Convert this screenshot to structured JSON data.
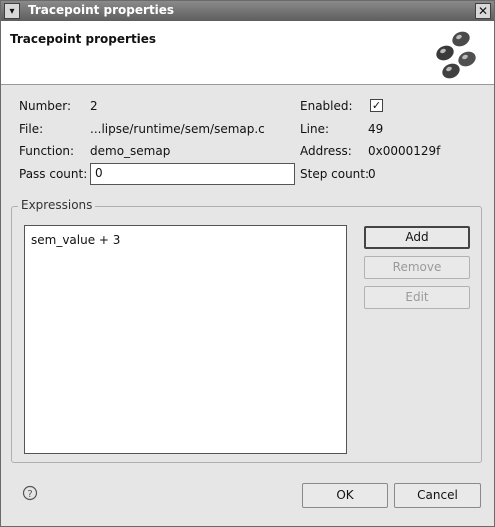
{
  "window": {
    "title": "Tracepoint properties",
    "menu_glyph": "▾",
    "close_glyph": "✕"
  },
  "header": {
    "title": "Tracepoint properties",
    "icon": "tracepoint-icon"
  },
  "fields": {
    "number_label": "Number:",
    "number_value": "2",
    "enabled_label": "Enabled:",
    "enabled_checked": true,
    "enabled_mark": "✓",
    "file_label": "File:",
    "file_value": "...lipse/runtime/sem/semap.c",
    "line_label": "Line:",
    "line_value": "49",
    "function_label": "Function:",
    "function_value": "demo_semap",
    "address_label": "Address:",
    "address_value": "0x0000129f",
    "pass_count_label": "Pass count:",
    "pass_count_value": "0",
    "step_count_label": "Step count:",
    "step_count_value": "0"
  },
  "expressions": {
    "group_label": "Expressions",
    "items": [
      "sem_value + 3"
    ],
    "add_label": "Add",
    "remove_label": "Remove",
    "edit_label": "Edit"
  },
  "footer": {
    "help_icon": "help-icon",
    "ok_label": "OK",
    "cancel_label": "Cancel"
  },
  "colors": {
    "titlebar": "#6f6f6f",
    "dialog_bg": "#e6e6e6",
    "banner_bg": "#ffffff",
    "disabled_text": "#9a9a9a"
  }
}
